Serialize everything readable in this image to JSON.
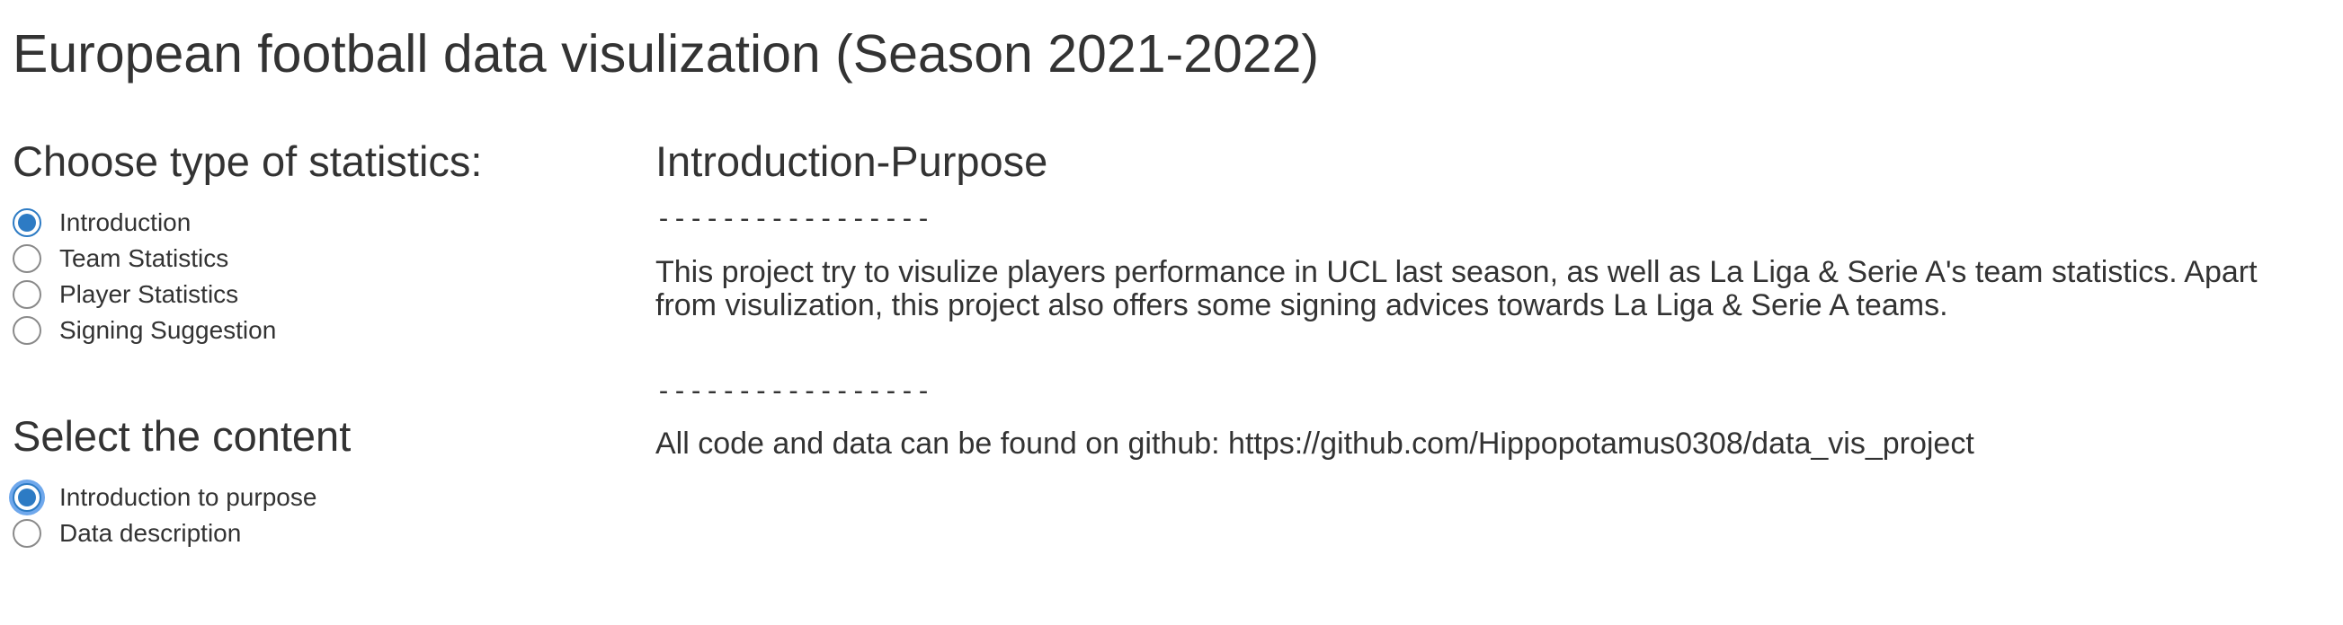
{
  "page": {
    "title": "European football data visulization (Season 2021-2022)"
  },
  "sidebar": {
    "statistics_heading": "Choose type of statistics:",
    "statistics_options": [
      {
        "label": "Introduction",
        "checked": true
      },
      {
        "label": "Team Statistics",
        "checked": false
      },
      {
        "label": "Player Statistics",
        "checked": false
      },
      {
        "label": "Signing Suggestion",
        "checked": false
      }
    ],
    "content_heading": "Select the content",
    "content_options": [
      {
        "label": "Introduction to purpose",
        "checked": true,
        "focused": true
      },
      {
        "label": "Data description",
        "checked": false
      }
    ]
  },
  "main": {
    "heading": "Introduction-Purpose",
    "divider_1": "-----------------",
    "paragraph_1": "This project try to visulize players performance in UCL last season, as well as La Liga & Serie A's team statistics. Apart from visulization, this project also offers some signing advices towards La Liga & Serie A teams.",
    "divider_2": "-----------------",
    "paragraph_2": "All code and data can be found on github: https://github.com/Hippopotamus0308/data_vis_project"
  },
  "colors": {
    "text": "#333333",
    "radio_checked": "#2d7bc4",
    "radio_border": "#8a8a8a",
    "focus_ring": "#6fa8ec"
  }
}
